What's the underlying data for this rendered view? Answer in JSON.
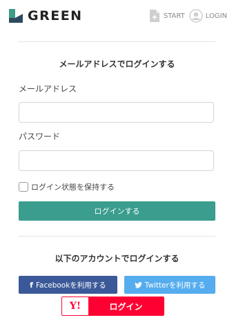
{
  "header": {
    "brand": "GREEN",
    "nav": [
      {
        "label": "START",
        "icon": "document-plus-icon"
      },
      {
        "label": "LOGIN",
        "icon": "user-icon"
      }
    ]
  },
  "login": {
    "title": "メールアドレスでログインする",
    "email_label": "メールアドレス",
    "email_value": "",
    "password_label": "パスワード",
    "password_value": "",
    "remember_label": "ログイン状態を保持する",
    "remember_checked": false,
    "submit_label": "ログインする"
  },
  "social": {
    "title": "以下のアカウントでログインする",
    "facebook_icon": "f",
    "facebook_label": "Facebookを利用する",
    "twitter_label": "Twitterを利用する",
    "yahoo_logo": "Y!",
    "yahoo_label": "ログイン"
  },
  "colors": {
    "accent": "#3a9d8e",
    "facebook": "#3b5998",
    "twitter": "#55acee",
    "yahoo": "#ff0033"
  }
}
